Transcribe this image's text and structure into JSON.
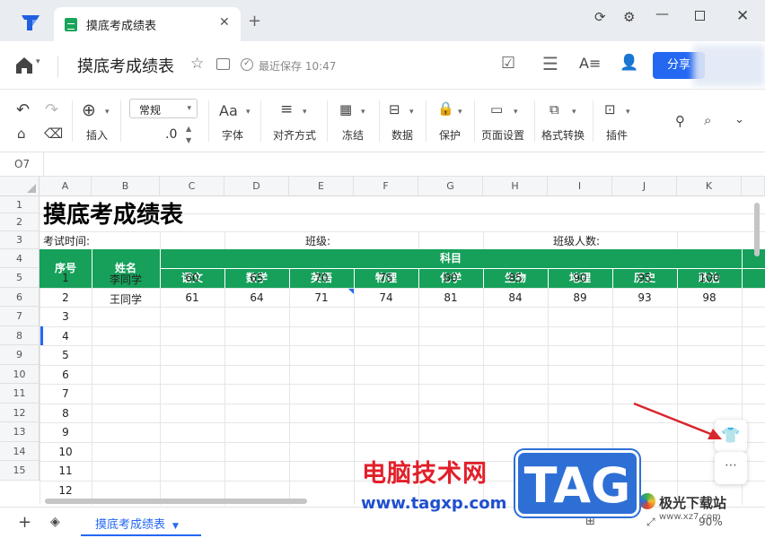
{
  "app": {
    "tab_title": "摸底考成绩表",
    "doc_title": "摸底考成绩表",
    "saved": "最近保存 10:47",
    "share": "分享"
  },
  "toolbar": {
    "insert": "插入",
    "style_value": "常规",
    "decimal": ".0",
    "font": "字体",
    "align": "对齐方式",
    "freeze": "冻结",
    "data": "数据",
    "protect": "保护",
    "page": "页面设置",
    "convert": "格式转换",
    "plugin": "插件"
  },
  "formula": {
    "cell": "O7"
  },
  "columns": [
    "A",
    "B",
    "C",
    "D",
    "E",
    "F",
    "G",
    "H",
    "I",
    "J",
    "K"
  ],
  "rows": [
    "1",
    "2",
    "3",
    "4",
    "5",
    "6",
    "7",
    "8",
    "9",
    "10",
    "11",
    "12",
    "13",
    "14",
    "15"
  ],
  "sheet": {
    "title": "摸底考成绩表",
    "exam_time": "考试时间:",
    "class": "班级:",
    "class_size": "班级人数:",
    "h_no": "序号",
    "h_name": "姓名",
    "h_subject": "科目",
    "subjects": [
      "语文",
      "数学",
      "英语",
      "物理",
      "化学",
      "生物",
      "地理",
      "历史",
      "政治"
    ],
    "students": [
      {
        "no": "1",
        "name": "李同学",
        "scores": [
          "60",
          "65",
          "70",
          "75",
          "80",
          "85",
          "90",
          "95",
          "100"
        ]
      },
      {
        "no": "2",
        "name": "王同学",
        "scores": [
          "61",
          "64",
          "71",
          "74",
          "81",
          "84",
          "89",
          "93",
          "98"
        ]
      }
    ],
    "extra_nos": [
      "3",
      "4",
      "5",
      "6",
      "7",
      "8",
      "9",
      "10",
      "11",
      "12"
    ]
  },
  "bottom": {
    "sheet_tab": "摸底考成绩表",
    "zoom": "90%"
  },
  "watermark": {
    "line1": "电脑技术网",
    "line2": "www.tagxp.com",
    "tag": "TAG",
    "site": "极光下载站",
    "site_url": "www.xz7.com"
  },
  "colors": {
    "accent": "#2468f2",
    "header_green": "#16a05a"
  }
}
